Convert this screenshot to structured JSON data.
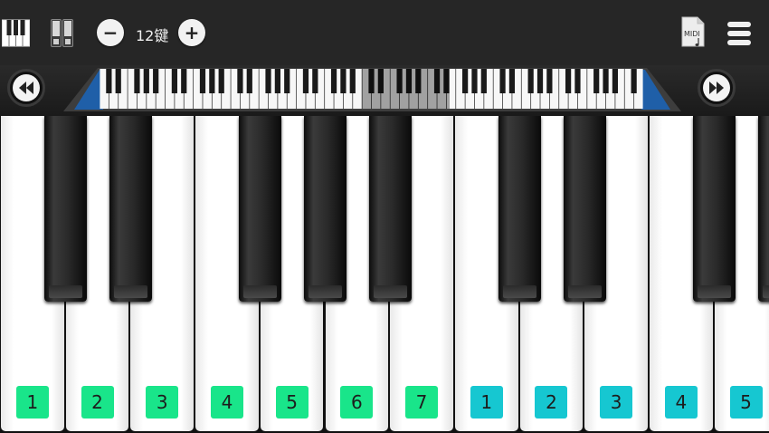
{
  "toolbar": {
    "key_count": "12键",
    "minus_label": "−",
    "plus_label": "+",
    "midi_label": "MIDI",
    "icons": [
      "piano-keys-icon",
      "dual-keyboard-icon",
      "minus-icon",
      "plus-icon",
      "midi-file-icon",
      "menu-icon"
    ]
  },
  "navigation": {
    "rewind_icon": "rewind-icon",
    "fast_forward_icon": "fast-forward-icon"
  },
  "keyboard": {
    "white_key_labels": [
      "1",
      "2",
      "3",
      "4",
      "5",
      "6",
      "7",
      "1",
      "2",
      "3",
      "4",
      "5"
    ],
    "label_colors": {
      "octave_low": "#19e58a",
      "octave_high": "#16c7d1"
    },
    "black_keys_visible": 9
  },
  "colors": {
    "toolbar_bg": "#262626",
    "button_face": "#f2f2f2",
    "range_highlight": "#1f5fa8"
  }
}
